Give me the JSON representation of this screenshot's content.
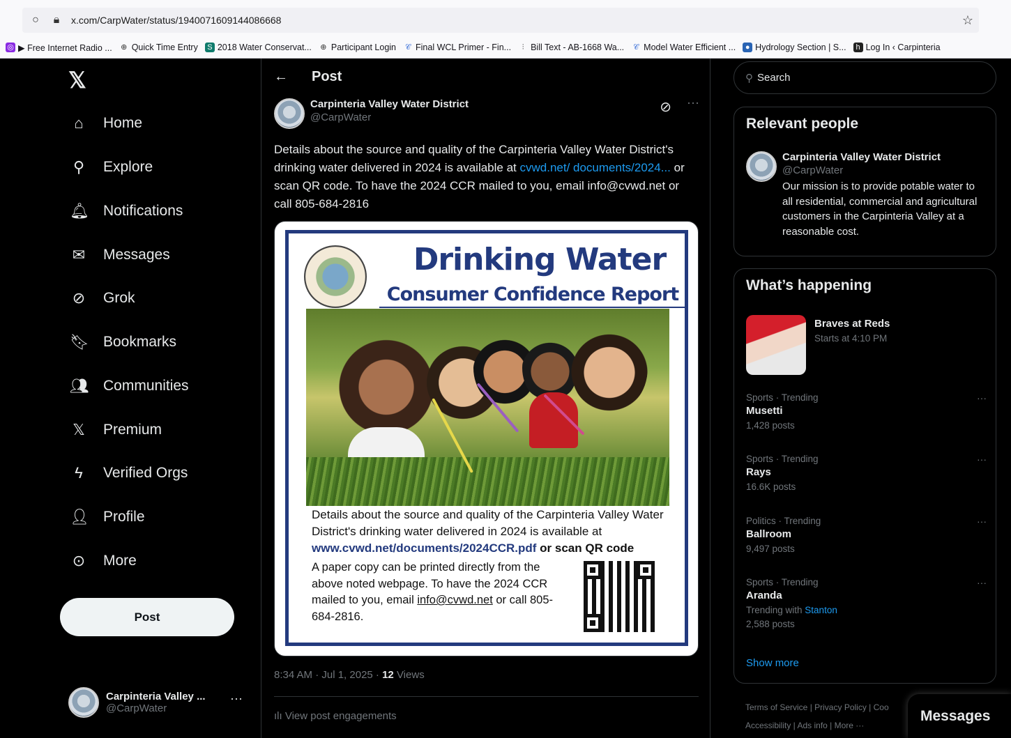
{
  "browser": {
    "url": "x.com/CarpWater/status/1940071609144086668",
    "bookmarks": [
      "▶ Free Internet Radio ...",
      "Quick Time Entry",
      "2018 Water Conservat...",
      "Participant Login",
      "Final WCL Primer - Fin...",
      "Bill Text - AB-1668 Wa...",
      "Model Water Efficient ...",
      "Hydrology Section | S...",
      "Log In ‹ Carpinteria"
    ]
  },
  "nav": {
    "items": [
      "Home",
      "Explore",
      "Notifications",
      "Messages",
      "Grok",
      "Bookmarks",
      "Communities",
      "Premium",
      "Verified Orgs",
      "Profile",
      "More"
    ],
    "post_button": "Post",
    "account_name": "Carpinteria Valley ...",
    "account_handle": "@CarpWater"
  },
  "main": {
    "title": "Post",
    "author_name": "Carpinteria Valley Water District",
    "author_handle": "@CarpWater",
    "text_part1": "Details about the source and quality of the Carpinteria Valley Water District's drinking water delivered in 2024 is available at ",
    "text_link": "cvwd.net/ documents/2024...",
    "text_part2": " or scan QR code.  To have the 2024 CCR mailed to you, email info@cvwd.net or call 805-684-2816",
    "flyer": {
      "title": "Drinking Water",
      "subtitle": "Consumer Confidence Report",
      "para1": "Details about the source and quality of the Carpinteria Valley Water District's drinking water delivered in 2024 is available at",
      "link": "www.cvwd.net/documents/2024CCR.pdf",
      "link_suffix": " or scan QR code",
      "para2_a": "A paper copy can be printed directly from the above noted webpage. To have the 2024 CCR mailed to you, email ",
      "email": "info@cvwd.net",
      "para2_b": " or call 805-684-2816."
    },
    "timestamp": "8:34 AM · Jul 1, 2025 · ",
    "views_count": "12",
    "views_label": " Views",
    "engagements": "View post engagements"
  },
  "right": {
    "search_placeholder": "Search",
    "relevant_title": "Relevant people",
    "rp_name": "Carpinteria Valley Water District",
    "rp_handle": "@CarpWater",
    "rp_bio": "Our mission is to provide potable water to all residential, commercial and agricultural customers in the Carpinteria Valley at a reasonable cost.",
    "happening_title": "What’s happening",
    "event_title": "Braves at Reds",
    "event_sub": "Starts at 4:10 PM",
    "trends": [
      {
        "ctx": "Sports · Trending",
        "name": "Musetti",
        "posts": "1,428 posts"
      },
      {
        "ctx": "Sports · Trending",
        "name": "Rays",
        "posts": "16.6K posts"
      },
      {
        "ctx": "Politics · Trending",
        "name": "Ballroom",
        "posts": "9,497 posts"
      },
      {
        "ctx": "Sports · Trending",
        "name": "Aranda",
        "with_label": "Trending with ",
        "with_link": "Stanton",
        "posts": "2,588 posts"
      }
    ],
    "show_more": "Show more",
    "footer_line1": "Terms of Service  |  Privacy Policy  |  Coo",
    "footer_line2": "Accessibility  |  Ads info  |  More ···"
  },
  "messages_drawer": "Messages"
}
